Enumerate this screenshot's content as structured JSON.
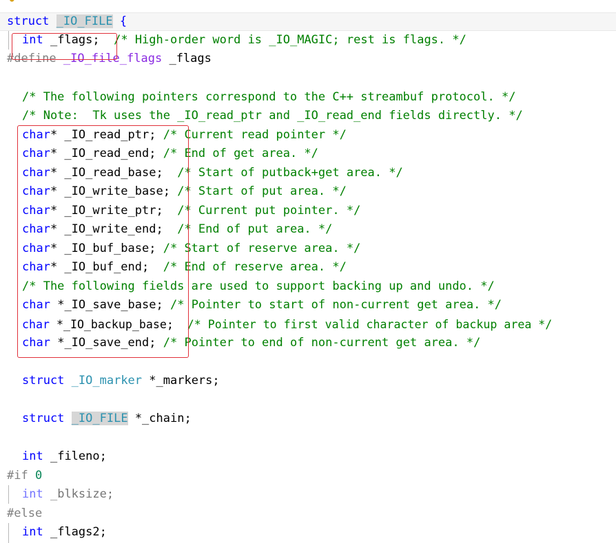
{
  "colors": {
    "keyword": "#0000ff",
    "type": "#2b91af",
    "comment": "#008000",
    "preprocessor": "#808080",
    "macro": "#8a2be2",
    "annotation_box": "#e0303a"
  },
  "code": {
    "l1": {
      "kw": "struct",
      "name": "_IO_FILE",
      "brace": "{"
    },
    "l2": {
      "kw": "int",
      "decl": "_flags;",
      "comment": "/* High-order word is _IO_MAGIC; rest is flags. */"
    },
    "l3": {
      "directive": "#define",
      "macro": "_IO_file_flags",
      "value": "_flags"
    },
    "l5": {
      "comment": "/* The following pointers correspond to the C++ streambuf protocol. */"
    },
    "l6": {
      "comment": "/* Note:  Tk uses the _IO_read_ptr and _IO_read_end fields directly. */"
    },
    "l7": {
      "kw": "char",
      "decl": "* _IO_read_ptr;",
      "comment": "/* Current read pointer */"
    },
    "l8": {
      "kw": "char",
      "decl": "* _IO_read_end;",
      "comment": "/* End of get area. */"
    },
    "l9": {
      "kw": "char",
      "decl": "* _IO_read_base;",
      "comment": "/* Start of putback+get area. */"
    },
    "l10": {
      "kw": "char",
      "decl": "* _IO_write_base;",
      "comment": "/* Start of put area. */"
    },
    "l11": {
      "kw": "char",
      "decl": "* _IO_write_ptr;",
      "comment": "/* Current put pointer. */"
    },
    "l12": {
      "kw": "char",
      "decl": "* _IO_write_end;",
      "comment": "/* End of put area. */"
    },
    "l13": {
      "kw": "char",
      "decl": "* _IO_buf_base;",
      "comment": "/* Start of reserve area. */"
    },
    "l14": {
      "kw": "char",
      "decl": "* _IO_buf_end;",
      "comment": "/* End of reserve area. */"
    },
    "l15": {
      "comment": "/* The following fields are used to support backing up and undo. */"
    },
    "l16": {
      "kw": "char",
      "decl": "*_IO_save_base;",
      "comment": "/* Pointer to start of non-current get area. */"
    },
    "l17": {
      "kw": "char",
      "decl": "*_IO_backup_base;",
      "comment": "/* Pointer to first valid character of backup area */"
    },
    "l18": {
      "kw": "char",
      "decl": "*_IO_save_end;",
      "comment": "/* Pointer to end of non-current get area. */"
    },
    "l20": {
      "kw": "struct",
      "type": "_IO_marker",
      "decl": "*_markers;"
    },
    "l22": {
      "kw": "struct",
      "type": "_IO_FILE",
      "decl": "*_chain;"
    },
    "l24": {
      "kw": "int",
      "decl": "_fileno;"
    },
    "l25": {
      "directive": "#if",
      "num": "0"
    },
    "l26": {
      "kw": "int",
      "decl": "_blksize;"
    },
    "l27": {
      "directive": "#else"
    },
    "l28": {
      "kw": "int",
      "decl": "_flags2;"
    }
  }
}
